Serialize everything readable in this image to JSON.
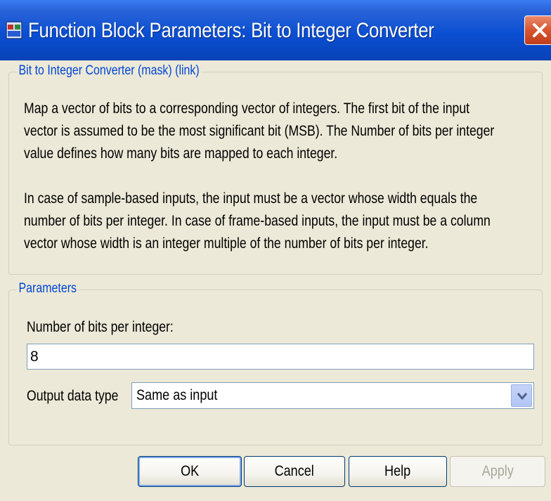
{
  "window": {
    "title": "Function Block Parameters: Bit to Integer Converter",
    "icon": "simulink-block-icon",
    "close_icon": "close-icon"
  },
  "description_group": {
    "legend": "Bit to Integer Converter (mask) (link)",
    "lines": [
      "Map a vector of bits to a corresponding vector of integers. The first bit of the input",
      "vector is assumed to be the most significant bit (MSB). The Number of bits per integer",
      "value defines how many bits are mapped to each integer.",
      "In case of sample-based inputs, the input must be a vector whose width equals the",
      "number of bits per integer. In case of frame-based inputs, the input must be a column",
      "vector whose width is an integer multiple of the number of bits per integer."
    ]
  },
  "parameters_group": {
    "legend": "Parameters",
    "bits_label": "Number of bits per integer:",
    "bits_value": "8",
    "output_type_label": "Output data type",
    "output_type_value": "Same as input"
  },
  "buttons": {
    "ok": "OK",
    "cancel": "Cancel",
    "help": "Help",
    "apply": "Apply"
  },
  "colors": {
    "titlebar": "#0a4fd2",
    "legend_text": "#0046d5",
    "dialog_bg": "#ece9d8",
    "close_button": "#d8552f"
  }
}
